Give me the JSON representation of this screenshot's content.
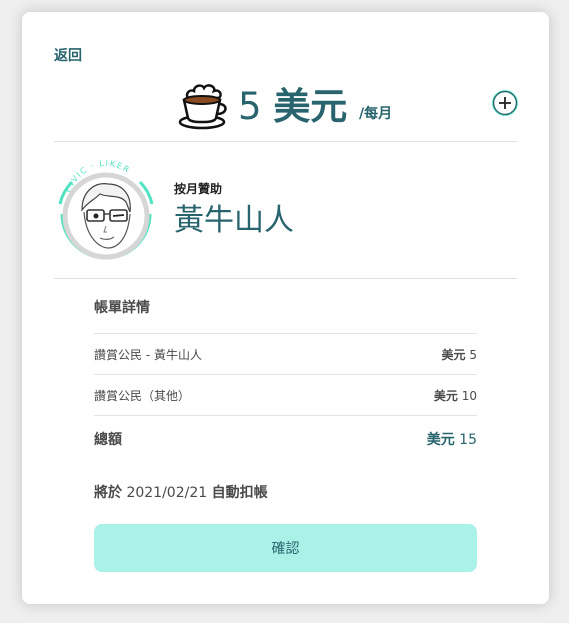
{
  "nav": {
    "back_label": "返回"
  },
  "price": {
    "number": "5",
    "currency": "美元",
    "period": "/每月"
  },
  "creator": {
    "sponsor_label": "按月贊助",
    "name": "黃牛山人",
    "badge_text": "CIVIC · LIKER"
  },
  "bill": {
    "title": "帳單詳情",
    "rows": [
      {
        "label": "讚賞公民 - 黃牛山人",
        "currency": "美元",
        "amount": "5"
      },
      {
        "label": "讚賞公民（其他）",
        "currency": "美元",
        "amount": "10"
      }
    ],
    "total": {
      "label": "總額",
      "currency": "美元",
      "amount": "15"
    }
  },
  "renewal": {
    "prefix": "將於",
    "date": "2021/02/21",
    "suffix": "自動扣帳"
  },
  "confirm_label": "確認",
  "colors": {
    "accent": "#28646e",
    "mint": "#50e3c2",
    "button": "#aaf1e7"
  },
  "icons": {
    "cup": "coffee-cup-icon",
    "plus": "plus-circle-icon"
  }
}
